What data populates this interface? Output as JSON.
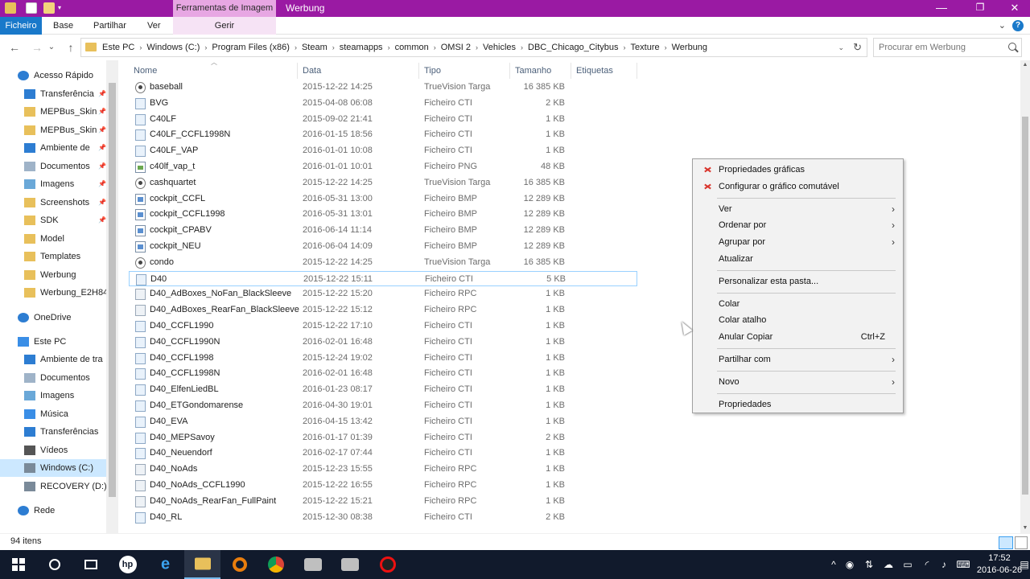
{
  "titlebar": {
    "context_group": "Ferramentas de Imagem",
    "title": "Werbung",
    "minimize": "—",
    "restore": "❐",
    "close": "✕"
  },
  "ribbon": {
    "tabs": [
      "Ficheiro",
      "Base",
      "Partilhar",
      "Ver"
    ],
    "context_tab": "Gerir",
    "collapse": "⌄",
    "help": "?"
  },
  "nav_buttons": {
    "back": "←",
    "forward": "→",
    "recent": "⌄",
    "up": "↑"
  },
  "address": {
    "crumbs": [
      "Este PC",
      "Windows (C:)",
      "Program Files (x86)",
      "Steam",
      "steamapps",
      "common",
      "OMSI 2",
      "Vehicles",
      "DBC_Chicago_Citybus",
      "Texture",
      "Werbung"
    ],
    "separator": "›",
    "dropdown": "⌄",
    "refresh": "↻"
  },
  "search": {
    "placeholder": "Procurar em Werbung"
  },
  "navpane": {
    "items": [
      {
        "label": "Acesso Rápido",
        "icon": "star",
        "color": "#2d7dd2",
        "indent": 1,
        "pinned": false
      },
      {
        "label": "Transferência",
        "icon": "download",
        "color": "#2d7dd2",
        "indent": 2,
        "pinned": true
      },
      {
        "label": "MEPBus_Skin",
        "icon": "folder",
        "color": "#e8c05b",
        "indent": 2,
        "pinned": true
      },
      {
        "label": "MEPBus_Skin",
        "icon": "folder",
        "color": "#e8c05b",
        "indent": 2,
        "pinned": true
      },
      {
        "label": "Ambiente de",
        "icon": "desktop",
        "color": "#2d7dd2",
        "indent": 2,
        "pinned": true
      },
      {
        "label": "Documentos",
        "icon": "documents",
        "color": "#9fb3c8",
        "indent": 2,
        "pinned": true
      },
      {
        "label": "Imagens",
        "icon": "pictures",
        "color": "#6aa8d8",
        "indent": 2,
        "pinned": true
      },
      {
        "label": "Screenshots",
        "icon": "folder",
        "color": "#e8c05b",
        "indent": 2,
        "pinned": true
      },
      {
        "label": "SDK",
        "icon": "folder",
        "color": "#e8c05b",
        "indent": 2,
        "pinned": true
      },
      {
        "label": "Model",
        "icon": "folder",
        "color": "#e8c05b",
        "indent": 2,
        "pinned": false
      },
      {
        "label": "Templates",
        "icon": "folder",
        "color": "#e8c05b",
        "indent": 2,
        "pinned": false
      },
      {
        "label": "Werbung",
        "icon": "folder",
        "color": "#e8c05b",
        "indent": 2,
        "pinned": false
      },
      {
        "label": "Werbung_E2H84",
        "icon": "folder",
        "color": "#e8c05b",
        "indent": 2,
        "pinned": false
      },
      {
        "label": "OneDrive",
        "icon": "cloud",
        "color": "#2d7dd2",
        "indent": 1,
        "pinned": false
      },
      {
        "label": "Este PC",
        "icon": "computer",
        "color": "#3a8ee6",
        "indent": 1,
        "pinned": false
      },
      {
        "label": "Ambiente de tra",
        "icon": "desktop",
        "color": "#2d7dd2",
        "indent": 2,
        "pinned": false
      },
      {
        "label": "Documentos",
        "icon": "documents",
        "color": "#9fb3c8",
        "indent": 2,
        "pinned": false
      },
      {
        "label": "Imagens",
        "icon": "pictures",
        "color": "#6aa8d8",
        "indent": 2,
        "pinned": false
      },
      {
        "label": "Música",
        "icon": "music",
        "color": "#3a8ee6",
        "indent": 2,
        "pinned": false
      },
      {
        "label": "Transferências",
        "icon": "download",
        "color": "#2d7dd2",
        "indent": 2,
        "pinned": false
      },
      {
        "label": "Vídeos",
        "icon": "videos",
        "color": "#555555",
        "indent": 2,
        "pinned": false
      },
      {
        "label": "Windows (C:)",
        "icon": "drive",
        "color": "#7a8a99",
        "indent": 2,
        "pinned": false,
        "selected": true
      },
      {
        "label": "RECOVERY (D:)",
        "icon": "drive",
        "color": "#7a8a99",
        "indent": 2,
        "pinned": false
      },
      {
        "label": "Rede",
        "icon": "network",
        "color": "#2d7dd2",
        "indent": 1,
        "pinned": false
      }
    ]
  },
  "columns": [
    "Nome",
    "Data",
    "Tipo",
    "Tamanho",
    "Etiquetas"
  ],
  "files": [
    {
      "name": "baseball",
      "date": "2015-12-22 14:25",
      "type": "TrueVision Targa",
      "size": "16 385 KB",
      "icon": "tga"
    },
    {
      "name": "BVG",
      "date": "2015-04-08 06:08",
      "type": "Ficheiro CTI",
      "size": "2 KB",
      "icon": "cti"
    },
    {
      "name": "C40LF",
      "date": "2015-09-02 21:41",
      "type": "Ficheiro CTI",
      "size": "1 KB",
      "icon": "cti"
    },
    {
      "name": "C40LF_CCFL1998N",
      "date": "2016-01-15 18:56",
      "type": "Ficheiro CTI",
      "size": "1 KB",
      "icon": "cti"
    },
    {
      "name": "C40LF_VAP",
      "date": "2016-01-01 10:08",
      "type": "Ficheiro CTI",
      "size": "1 KB",
      "icon": "cti"
    },
    {
      "name": "c40lf_vap_t",
      "date": "2016-01-01 10:01",
      "type": "Ficheiro PNG",
      "size": "48 KB",
      "icon": "png"
    },
    {
      "name": "cashquartet",
      "date": "2015-12-22 14:25",
      "type": "TrueVision Targa",
      "size": "16 385 KB",
      "icon": "tga"
    },
    {
      "name": "cockpit_CCFL",
      "date": "2016-05-31 13:00",
      "type": "Ficheiro BMP",
      "size": "12 289 KB",
      "icon": "bmp"
    },
    {
      "name": "cockpit_CCFL1998",
      "date": "2016-05-31 13:01",
      "type": "Ficheiro BMP",
      "size": "12 289 KB",
      "icon": "bmp"
    },
    {
      "name": "cockpit_CPABV",
      "date": "2016-06-14 11:14",
      "type": "Ficheiro BMP",
      "size": "12 289 KB",
      "icon": "bmp"
    },
    {
      "name": "cockpit_NEU",
      "date": "2016-06-04 14:09",
      "type": "Ficheiro BMP",
      "size": "12 289 KB",
      "icon": "bmp"
    },
    {
      "name": "condo",
      "date": "2015-12-22 14:25",
      "type": "TrueVision Targa",
      "size": "16 385 KB",
      "icon": "tga"
    },
    {
      "name": "D40",
      "date": "2015-12-22 15:11",
      "type": "Ficheiro CTI",
      "size": "5 KB",
      "icon": "cti",
      "focused": true
    },
    {
      "name": "D40_AdBoxes_NoFan_BlackSleeve",
      "date": "2015-12-22 15:20",
      "type": "Ficheiro RPC",
      "size": "1 KB",
      "icon": "rpc"
    },
    {
      "name": "D40_AdBoxes_RearFan_BlackSleeve",
      "date": "2015-12-22 15:12",
      "type": "Ficheiro RPC",
      "size": "1 KB",
      "icon": "rpc"
    },
    {
      "name": "D40_CCFL1990",
      "date": "2015-12-22 17:10",
      "type": "Ficheiro CTI",
      "size": "1 KB",
      "icon": "cti"
    },
    {
      "name": "D40_CCFL1990N",
      "date": "2016-02-01 16:48",
      "type": "Ficheiro CTI",
      "size": "1 KB",
      "icon": "cti"
    },
    {
      "name": "D40_CCFL1998",
      "date": "2015-12-24 19:02",
      "type": "Ficheiro CTI",
      "size": "1 KB",
      "icon": "cti"
    },
    {
      "name": "D40_CCFL1998N",
      "date": "2016-02-01 16:48",
      "type": "Ficheiro CTI",
      "size": "1 KB",
      "icon": "cti"
    },
    {
      "name": "D40_ElfenLiedBL",
      "date": "2016-01-23 08:17",
      "type": "Ficheiro CTI",
      "size": "1 KB",
      "icon": "cti"
    },
    {
      "name": "D40_ETGondomarense",
      "date": "2016-04-30 19:01",
      "type": "Ficheiro CTI",
      "size": "1 KB",
      "icon": "cti"
    },
    {
      "name": "D40_EVA",
      "date": "2016-04-15 13:42",
      "type": "Ficheiro CTI",
      "size": "1 KB",
      "icon": "cti"
    },
    {
      "name": "D40_MEPSavoy",
      "date": "2016-01-17 01:39",
      "type": "Ficheiro CTI",
      "size": "2 KB",
      "icon": "cti"
    },
    {
      "name": "D40_Neuendorf",
      "date": "2016-02-17 07:44",
      "type": "Ficheiro CTI",
      "size": "1 KB",
      "icon": "cti"
    },
    {
      "name": "D40_NoAds",
      "date": "2015-12-23 15:55",
      "type": "Ficheiro RPC",
      "size": "1 KB",
      "icon": "rpc"
    },
    {
      "name": "D40_NoAds_CCFL1990",
      "date": "2015-12-22 16:55",
      "type": "Ficheiro RPC",
      "size": "1 KB",
      "icon": "rpc"
    },
    {
      "name": "D40_NoAds_RearFan_FullPaint",
      "date": "2015-12-22 15:21",
      "type": "Ficheiro RPC",
      "size": "1 KB",
      "icon": "rpc"
    },
    {
      "name": "D40_RL",
      "date": "2015-12-30 08:38",
      "type": "Ficheiro CTI",
      "size": "2 KB",
      "icon": "cti"
    }
  ],
  "status": {
    "count": "94 itens"
  },
  "context_menu": {
    "items": [
      {
        "label": "Propriedades gráficas",
        "icon": "graphics-icon"
      },
      {
        "label": "Configurar o gráfico comutável",
        "icon": "graphics-icon"
      },
      {
        "sep": true
      },
      {
        "label": "Ver",
        "submenu": true
      },
      {
        "label": "Ordenar por",
        "submenu": true
      },
      {
        "label": "Agrupar por",
        "submenu": true
      },
      {
        "label": "Atualizar"
      },
      {
        "sep": true
      },
      {
        "label": "Personalizar esta pasta..."
      },
      {
        "sep": true
      },
      {
        "label": "Colar"
      },
      {
        "label": "Colar atalho"
      },
      {
        "label": "Anular Copiar",
        "shortcut": "Ctrl+Z"
      },
      {
        "sep": true
      },
      {
        "label": "Partilhar com",
        "submenu": true
      },
      {
        "sep": true
      },
      {
        "label": "Novo",
        "submenu": true
      },
      {
        "sep": true
      },
      {
        "label": "Propriedades"
      }
    ],
    "arrow": "›"
  },
  "taskbar": {
    "apps": [
      "start",
      "search",
      "task-view",
      "hp",
      "edge",
      "file-explorer",
      "blender",
      "chrome",
      "omsi-1",
      "omsi-2",
      "recorder"
    ],
    "active": "file-explorer",
    "tray_icons": [
      "chevron-up",
      "steam",
      "network-share",
      "onedrive",
      "battery",
      "wifi",
      "volume",
      "keyboard",
      "notifications"
    ],
    "time": "17:52",
    "date": "2016-06-26"
  }
}
